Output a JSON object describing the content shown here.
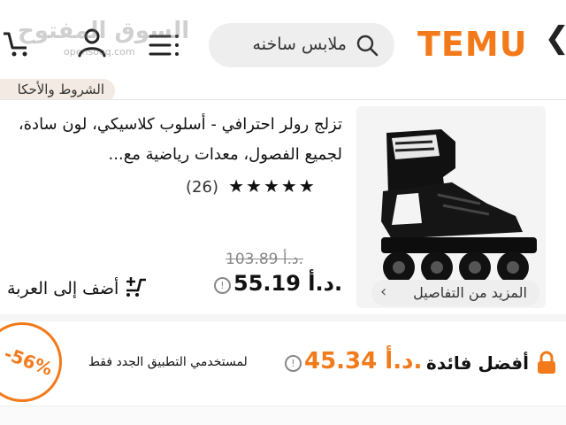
{
  "header": {
    "logo": "TEMU",
    "close_glyph": "❮",
    "search_placeholder": "ملابس ساخنه",
    "watermark_text": "السوق المفتوح",
    "watermark_sub": "opensooq.com",
    "icons": [
      "close-icon",
      "search-icon",
      "menu-icon",
      "user-icon",
      "cart-icon"
    ]
  },
  "terms": {
    "label": "الشروط والأحكا"
  },
  "product": {
    "title": "تزلج رولر احترافي - أسلوب كلاسيكي، لون سادة، لجميع الفصول، معدات رياضية مع...",
    "rating_stars": 5,
    "star_glyph": "★",
    "reviews": "(26)",
    "old_price": "103.89 د.أ.",
    "price": "55.19 د.أ.",
    "info_glyph": "!",
    "add_to_cart": "أضف إلى العربة",
    "details_label": "المزيد من التفاصيل",
    "details_chevron": "‹"
  },
  "promo": {
    "best_label": "أفضل فائدة",
    "best_price": "45.34 د.أ.",
    "note": "لمستخدمي التطبيق الجدد فقط",
    "badge": "-56%"
  },
  "colors": {
    "accent": "#f27a1a",
    "text": "#111111",
    "muted": "#888888"
  }
}
